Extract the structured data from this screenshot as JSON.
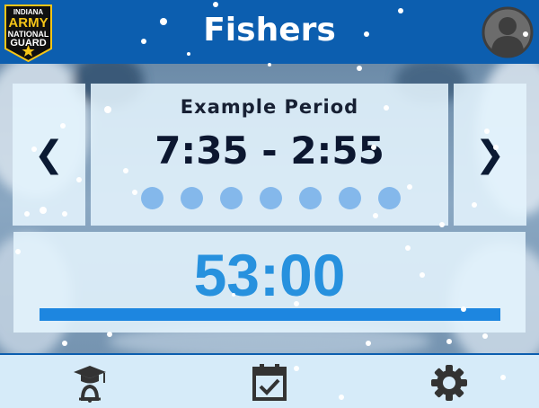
{
  "header": {
    "title": "Fishers",
    "logo": {
      "line1": "INDIANA",
      "line2": "ARMY",
      "line3": "NATIONAL",
      "line4": "GUARD"
    }
  },
  "period": {
    "name": "Example Period",
    "time_range": "7:35 - 2:55",
    "dot_count": 7
  },
  "navigation": {
    "prev_label": "❮",
    "next_label": "❯"
  },
  "timer": {
    "countdown": "53:00",
    "progress_fraction": 1.0
  },
  "footer": {
    "icons": [
      "graduation-bell-icon",
      "calendar-check-icon",
      "gear-icon"
    ]
  },
  "colors": {
    "header": "#0c5eaf",
    "accent": "#1d86e0",
    "countdown": "#2791de",
    "dot": "#84b8eb",
    "footer": "#d6ebf9"
  }
}
